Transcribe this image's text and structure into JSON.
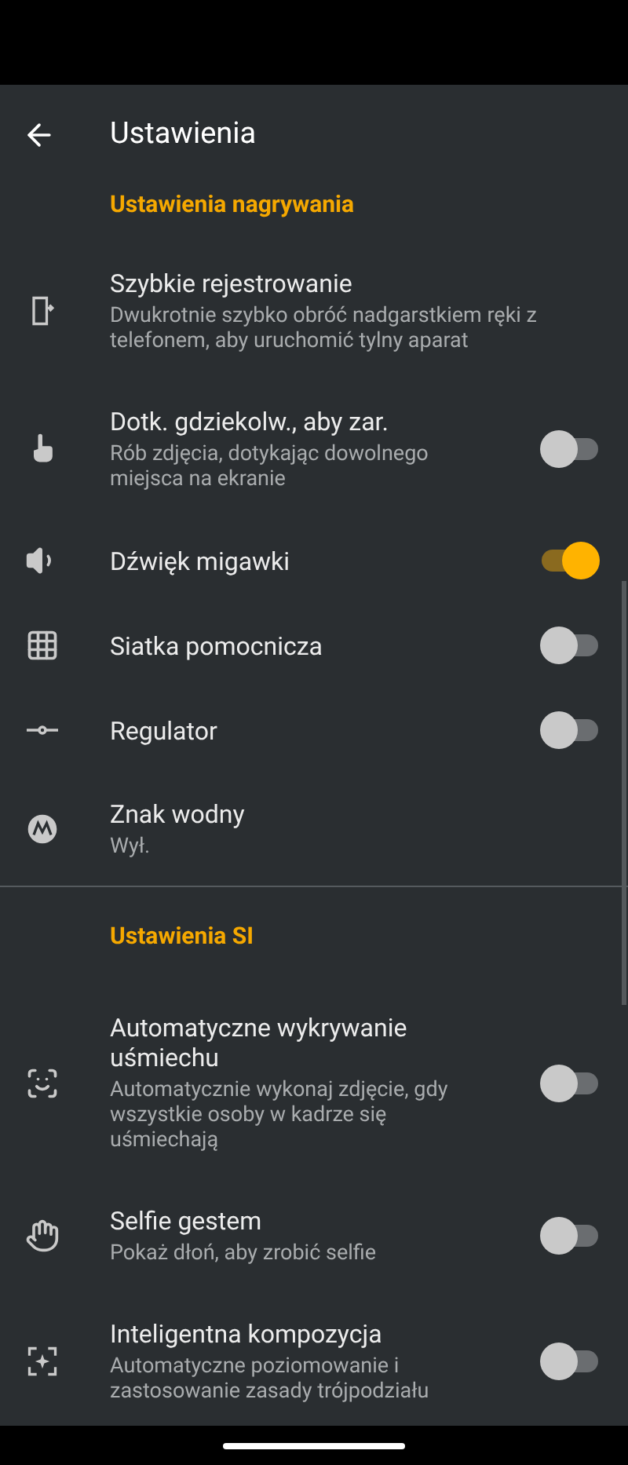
{
  "app_bar": {
    "title": "Ustawienia"
  },
  "sections": [
    {
      "header": "Ustawienia nagrywania",
      "items": [
        {
          "kind": "plain",
          "title": "Szybkie rejestrowanie",
          "description": "Dwukrotnie szybko obróć nadgarstkiem ręki z telefonem, aby uruchomić tylny aparat"
        },
        {
          "kind": "toggle",
          "title": "Dotk. gdziekolw., aby zar.",
          "description": "Rób zdjęcia, dotykając dowolnego miejsca na ekranie",
          "on": false
        },
        {
          "kind": "toggle",
          "title": "Dźwięk migawki",
          "on": true
        },
        {
          "kind": "toggle",
          "title": "Siatka pomocnicza",
          "on": false
        },
        {
          "kind": "toggle",
          "title": "Regulator",
          "on": false
        },
        {
          "kind": "plain",
          "title": "Znak wodny",
          "description": "Wył."
        }
      ]
    },
    {
      "header": "Ustawienia SI",
      "items": [
        {
          "kind": "toggle",
          "title": "Automatyczne wykrywanie uśmiechu",
          "description": "Automatycznie wykonaj zdjęcie, gdy wszystkie osoby w kadrze się uśmiechają",
          "on": false
        },
        {
          "kind": "toggle",
          "title": "Selfie gestem",
          "description": "Pokaż dłoń, aby zrobić selfie",
          "on": false
        },
        {
          "kind": "toggle",
          "title": "Inteligentna kompozycja",
          "description": "Automatyczne poziomowanie i zastosowanie zasady trójpodziału",
          "on": false
        }
      ]
    }
  ]
}
